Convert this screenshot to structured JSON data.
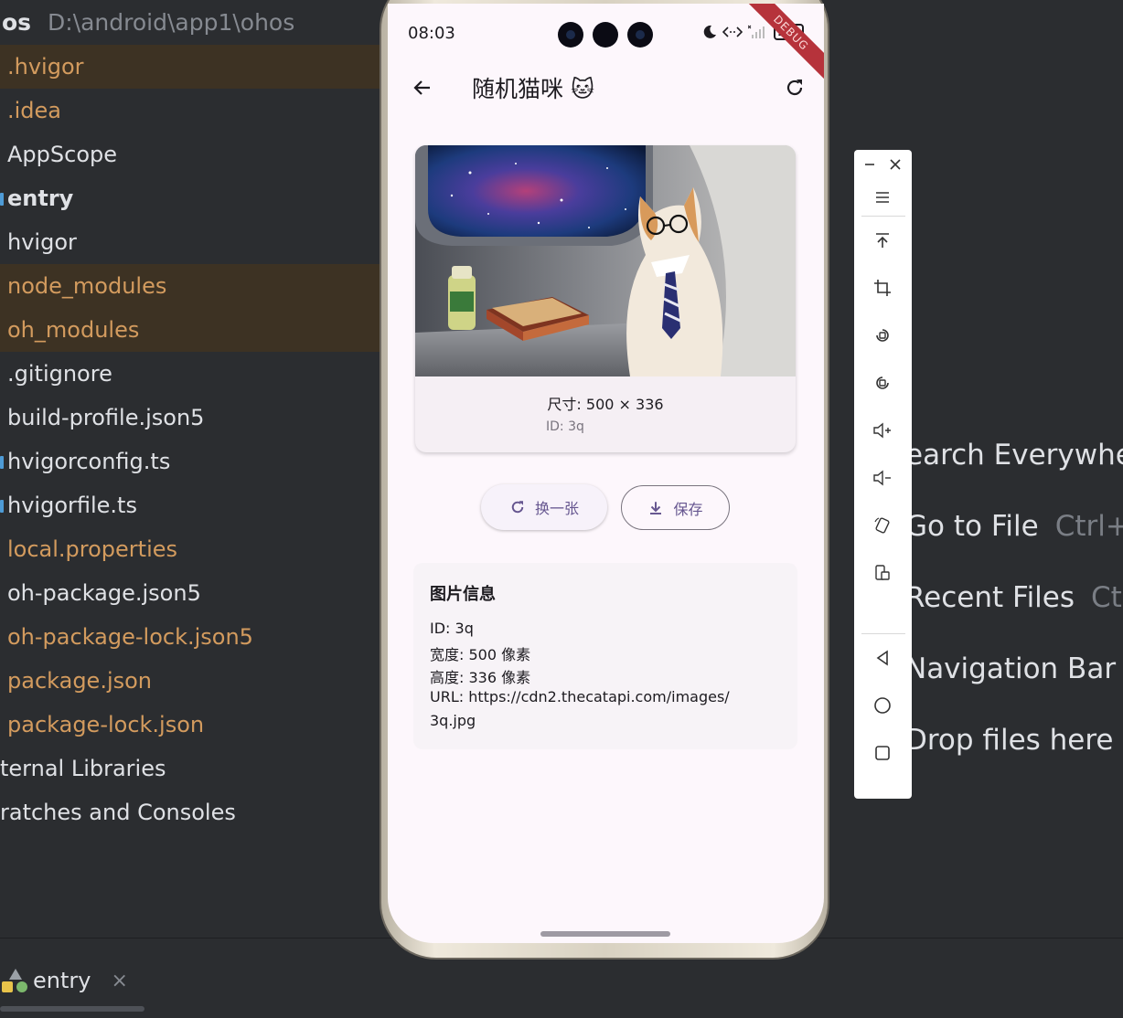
{
  "ide": {
    "project_name": "os",
    "project_path": "D:\\android\\app1\\ohos",
    "tree": [
      {
        "label": ".hvigor",
        "style": "orange",
        "excluded": true
      },
      {
        "label": ".idea",
        "style": "orange",
        "excluded": false
      },
      {
        "label": "AppScope",
        "style": "white",
        "excluded": false
      },
      {
        "label": "entry",
        "style": "white-bold",
        "excluded": false
      },
      {
        "label": "hvigor",
        "style": "white",
        "excluded": false
      },
      {
        "label": "node_modules",
        "style": "orange",
        "excluded": true
      },
      {
        "label": "oh_modules",
        "style": "orange",
        "excluded": true
      },
      {
        "label": ".gitignore",
        "style": "white",
        "excluded": false
      },
      {
        "label": "build-profile.json5",
        "style": "white",
        "excluded": false
      },
      {
        "label": "hvigorconfig.ts",
        "style": "white",
        "excluded": false
      },
      {
        "label": "hvigorfile.ts",
        "style": "white",
        "excluded": false
      },
      {
        "label": "local.properties",
        "style": "orange",
        "excluded": false
      },
      {
        "label": "oh-package.json5",
        "style": "white",
        "excluded": false
      },
      {
        "label": "oh-package-lock.json5",
        "style": "orange",
        "excluded": false
      },
      {
        "label": "package.json",
        "style": "orange",
        "excluded": false
      },
      {
        "label": "package-lock.json",
        "style": "orange",
        "excluded": false
      },
      {
        "label": "ternal Libraries",
        "style": "white",
        "excluded": false
      },
      {
        "label": "ratches and Consoles",
        "style": "white",
        "excluded": false
      }
    ],
    "run_tab": {
      "label": "entry",
      "close": "×"
    },
    "hints": [
      {
        "text": "earch Everywhe",
        "key": ""
      },
      {
        "text": "Go to File",
        "key": "Ctrl+"
      },
      {
        "text": "Recent Files",
        "key": "Ctr"
      },
      {
        "text": "Navigation Bar",
        "key": ""
      },
      {
        "text": "Drop files here t",
        "key": ""
      }
    ]
  },
  "tool_panel": {
    "icons": [
      "minimize-icon",
      "close-icon",
      "menu-icon",
      "pin-top-icon",
      "crop-icon",
      "rotate-left-icon",
      "rotate-right-icon",
      "volume-up-icon",
      "volume-down-icon",
      "screen-rotate-icon",
      "screenshot-icon",
      "back-nav-icon",
      "home-nav-icon",
      "recents-nav-icon"
    ]
  },
  "phone": {
    "status": {
      "time": "08:03",
      "battery": "100",
      "debug_banner": "DEBUG"
    },
    "app_bar": {
      "title": "随机猫咪 🐱"
    },
    "card": {
      "size_text": "尺寸: 500 × 336",
      "id_text": "ID: 3q"
    },
    "buttons": {
      "change_label": "换一张",
      "save_label": "保存"
    },
    "info": {
      "title": "图片信息",
      "id_line": "ID: 3q",
      "width_line": "宽度: 500 像素",
      "height_line": "高度: 336 像素",
      "url_line1": "URL: https://cdn2.thecatapi.com/images/",
      "url_line2": "3q.jpg"
    }
  },
  "colors": {
    "ide_bg": "#2b2d30",
    "excluded_bg": "#3d3223",
    "orange_text": "#d39b5e",
    "phone_bg": "#fdf7fc",
    "primary": "#65558f",
    "debug_ribbon": "#b6333b"
  }
}
